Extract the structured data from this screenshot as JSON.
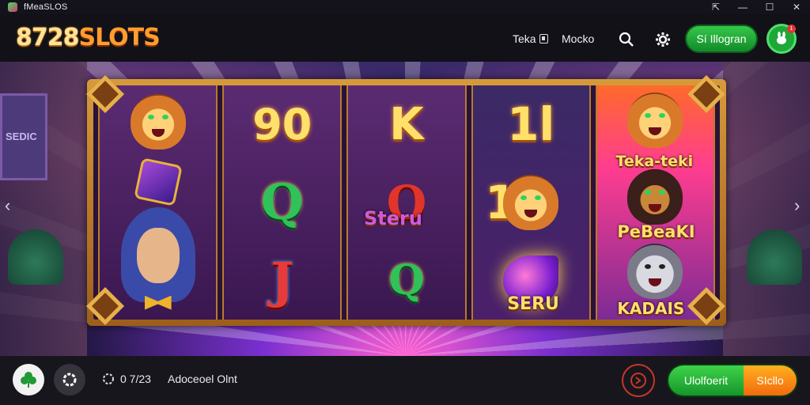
{
  "window": {
    "title": "fMeaSLOS",
    "controls": [
      "share-icon",
      "minimize-icon",
      "maximize-icon",
      "close-icon"
    ]
  },
  "header": {
    "logo_number": "8728",
    "logo_text": "SLOTS",
    "link_teka": "Teka",
    "link_mocko": "Mocko",
    "signin_label": "Sí Illogran",
    "notification_count": "1"
  },
  "reels": {
    "col1": {
      "word_pill": ""
    },
    "col2": {
      "top": "90",
      "mid": "Q",
      "bottom": "J"
    },
    "col3": {
      "top": "K",
      "mid": "O",
      "word": "Steru",
      "bottom": "Q"
    },
    "col4": {
      "top": "1l",
      "mid": "1",
      "word": "SERU"
    },
    "col5": {
      "word1": "Teka-teki",
      "word2": "PeBeaKI",
      "word3": "KADAIS"
    }
  },
  "sign_left": "SEDIC",
  "colors": {
    "accent_green": "#1fa83a",
    "accent_orange": "#ff9d2d",
    "frame_gold": "#d79a3a"
  },
  "bottom": {
    "stat_value": "0 7/23",
    "status_text": "Adoceoel Olnt",
    "combo_green": "Ulolfoerit",
    "combo_orange": "SIcllo"
  }
}
